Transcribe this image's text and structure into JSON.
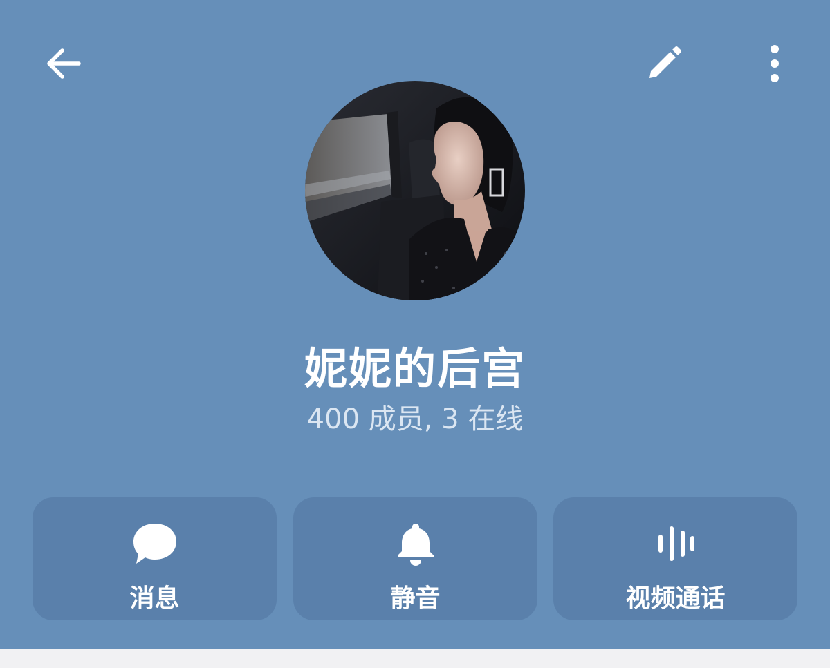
{
  "colors": {
    "header_background": "#668fb9",
    "button_background": "#5a80ab",
    "text_primary": "#ffffff",
    "text_secondary": "#dbe6f2",
    "page_background": "#f1f1f3"
  },
  "topbar": {
    "back_icon": "arrow-left-icon",
    "edit_icon": "pencil-icon",
    "more_icon": "more-vertical-icon"
  },
  "profile": {
    "avatar": "group-avatar-photo",
    "name": "妮妮的后宫",
    "status": "400 成员, 3 在线"
  },
  "actions": [
    {
      "icon": "chat-bubble-icon",
      "label": "消息"
    },
    {
      "icon": "bell-icon",
      "label": "静音"
    },
    {
      "icon": "voice-wave-icon",
      "label": "视频通话"
    }
  ]
}
